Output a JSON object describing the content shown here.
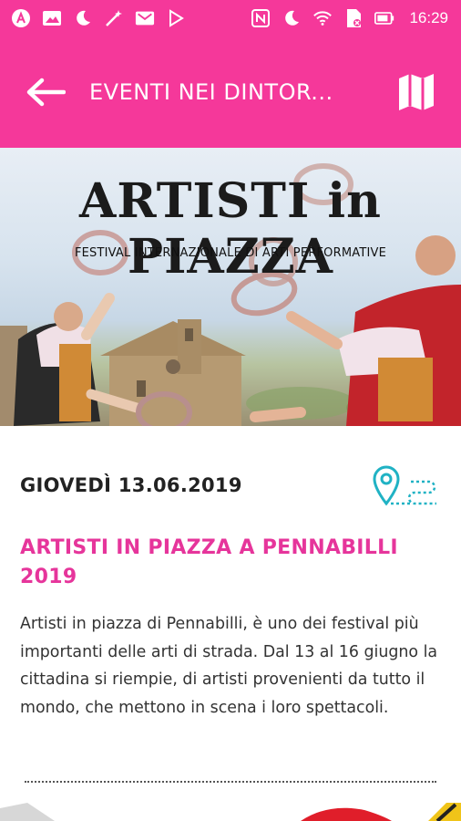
{
  "status_bar": {
    "time": "16:29",
    "icons_left": [
      "app-icon",
      "image-icon",
      "moon-icon",
      "wand-icon",
      "mail-icon",
      "play-icon"
    ],
    "icons_right": [
      "nfc-icon",
      "moon-icon",
      "wifi-icon",
      "sim-icon",
      "battery-icon"
    ]
  },
  "app_bar": {
    "title": "EVENTI NEI DINTOR...",
    "back_icon": "arrow-left-icon",
    "map_icon": "map-icon"
  },
  "hero": {
    "title": "ARTISTI in PIAZZA",
    "subtitle": "FESTIVAL INTERNAZIONALE DI ARTI PERFORMATIVE"
  },
  "event": {
    "date": "GIOVEDÌ 13.06.2019",
    "route_icon": "route-pin-icon",
    "title": "ARTISTI IN PIAZZA A PENNABILLI 2019",
    "description": "Artisti in piazza di Pennabilli, è uno dei festival più importanti delle arti di strada. Dal 13 al 16 giugno la cittadina si riempie, di artisti provenienti da tutto il mondo, che mettono in scena i loro spettacoli."
  },
  "colors": {
    "brand_pink": "#f5389a",
    "title_pink": "#e6359b",
    "route_teal": "#20b2c4",
    "text_dark": "#222222"
  }
}
